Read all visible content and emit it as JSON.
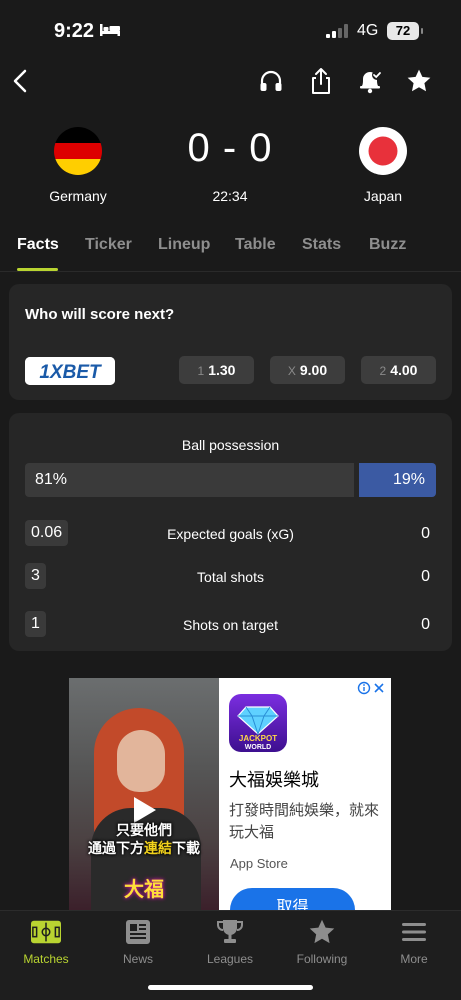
{
  "status_bar": {
    "time": "9:22",
    "network": "4G",
    "battery": "72"
  },
  "match": {
    "home": {
      "name": "Germany"
    },
    "away": {
      "name": "Japan"
    },
    "score": "0 - 0",
    "time": "22:34"
  },
  "tabs": [
    {
      "label": "Facts"
    },
    {
      "label": "Ticker"
    },
    {
      "label": "Lineup"
    },
    {
      "label": "Table"
    },
    {
      "label": "Stats"
    },
    {
      "label": "Buzz"
    }
  ],
  "betting": {
    "title": "Who will score next?",
    "brand": "1XBET",
    "odds": [
      {
        "label": "1",
        "value": "1.30"
      },
      {
        "label": "X",
        "value": "9.00"
      },
      {
        "label": "2",
        "value": "4.00"
      }
    ]
  },
  "stats": {
    "possession_title": "Ball possession",
    "possession_home": "81%",
    "possession_away": "19%",
    "possession_home_fraction": 0.81,
    "rows": [
      {
        "home": "0.06",
        "label": "Expected goals (xG)",
        "away": "0"
      },
      {
        "home": "3",
        "label": "Total shots",
        "away": "0"
      },
      {
        "home": "1",
        "label": "Shots on target",
        "away": "0"
      }
    ]
  },
  "ad": {
    "caption_line1": "只要他們",
    "caption_line2_a": "通過下方",
    "caption_line2_hl": "連結",
    "caption_line2_b": "下載",
    "brand_text": "大福",
    "app_icon_text_1": "JACKPOT",
    "app_icon_text_2": "WORLD",
    "app_name": "大福娛樂城",
    "description": "打發時間純娛樂，就來玩大福",
    "store": "App Store",
    "cta": "取得"
  },
  "bottom_nav": [
    {
      "label": "Matches",
      "icon": "pitch-icon"
    },
    {
      "label": "News",
      "icon": "news-icon"
    },
    {
      "label": "Leagues",
      "icon": "trophy-icon"
    },
    {
      "label": "Following",
      "icon": "star-icon"
    },
    {
      "label": "More",
      "icon": "menu-icon"
    }
  ],
  "colors": {
    "accent": "#b9d431",
    "away_possession": "#3b5aa3",
    "background": "#1a1a1a",
    "card": "#262626"
  }
}
